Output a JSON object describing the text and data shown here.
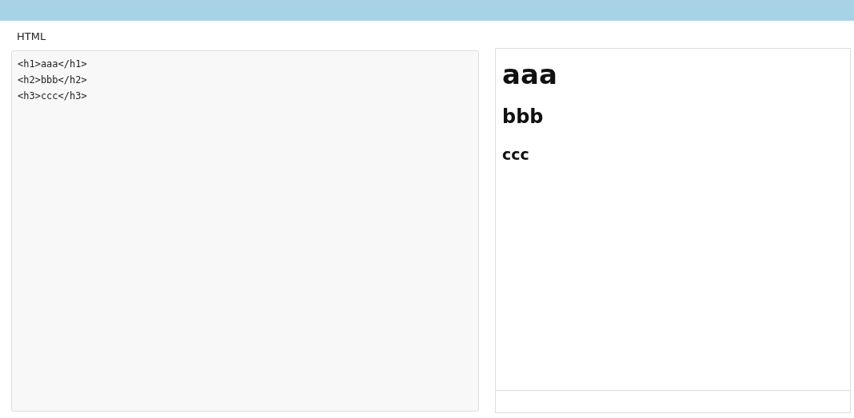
{
  "label": "HTML",
  "editor": {
    "value": "<h1>aaa</h1>\n<h2>bbb</h2>\n<h3>ccc</h3>"
  },
  "preview": {
    "headings": [
      {
        "kind": "h1",
        "text": "aaa"
      },
      {
        "kind": "h2",
        "text": "bbb"
      },
      {
        "kind": "h3",
        "text": "ccc"
      }
    ]
  }
}
